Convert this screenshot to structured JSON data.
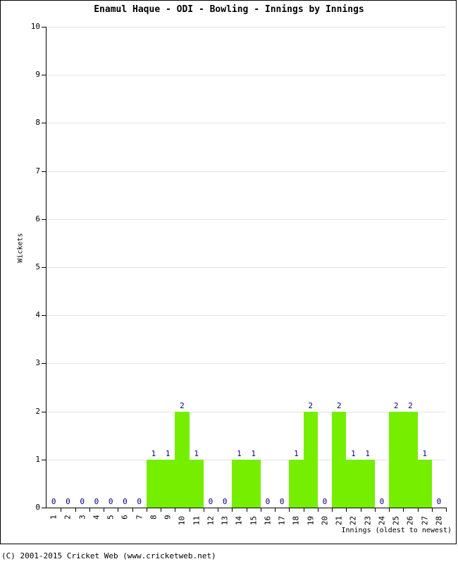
{
  "chart_data": {
    "type": "bar",
    "title": "Enamul Haque - ODI - Bowling - Innings by Innings",
    "xlabel": "Innings (oldest to newest)",
    "ylabel": "Wickets",
    "categories": [
      "1",
      "2",
      "3",
      "4",
      "5",
      "6",
      "7",
      "8",
      "9",
      "10",
      "11",
      "12",
      "13",
      "14",
      "15",
      "16",
      "17",
      "18",
      "19",
      "20",
      "21",
      "22",
      "23",
      "24",
      "25",
      "26",
      "27",
      "28"
    ],
    "values": [
      0,
      0,
      0,
      0,
      0,
      0,
      0,
      1,
      1,
      2,
      1,
      0,
      0,
      1,
      1,
      0,
      0,
      1,
      2,
      0,
      2,
      1,
      1,
      0,
      2,
      2,
      1,
      0
    ],
    "ylim": [
      0,
      10
    ],
    "yticks": [
      0,
      1,
      2,
      3,
      4,
      5,
      6,
      7,
      8,
      9,
      10
    ],
    "grid": true,
    "legend": false,
    "bar_color": "#76ee00",
    "value_label_color": "#000080",
    "gridline_color": "#e3e3e3",
    "axis_color": "#000000"
  },
  "footer": {
    "copyright": "(C) 2001-2015 Cricket Web (www.cricketweb.net)"
  }
}
